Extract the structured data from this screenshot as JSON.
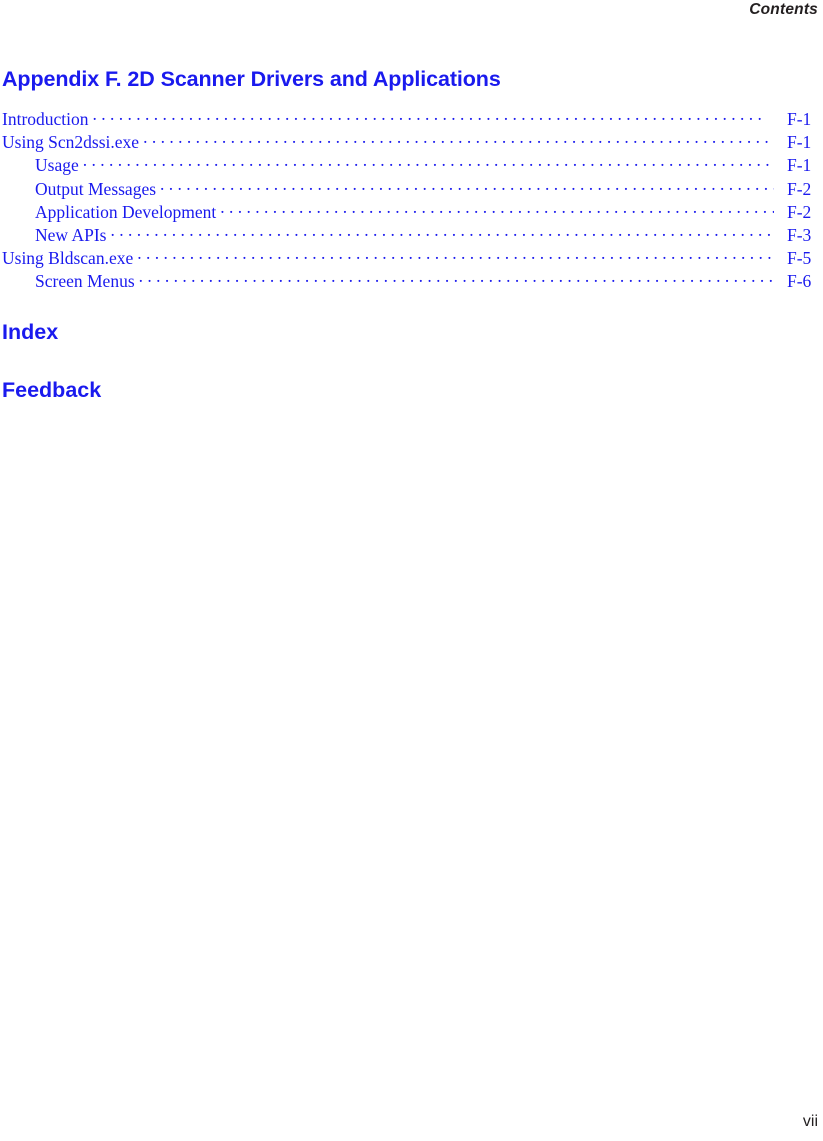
{
  "header": {
    "running_head": "Contents"
  },
  "appendix": {
    "title": "Appendix F. 2D Scanner Drivers and Applications"
  },
  "toc": {
    "entries": [
      {
        "label": "Introduction",
        "page": "F-1",
        "level": 1,
        "gap": "wide"
      },
      {
        "label": "Using Scn2dssi.exe",
        "page": "F-1",
        "level": 1,
        "gap": "small"
      },
      {
        "label": "Usage",
        "page": "F-1",
        "level": 2,
        "gap": "mid"
      },
      {
        "label": "Output Messages",
        "page": "F-2",
        "level": 2,
        "gap": "small"
      },
      {
        "label": "Application Development",
        "page": "F-2",
        "level": 2,
        "gap": "small"
      },
      {
        "label": "New APIs",
        "page": "F-3",
        "level": 2,
        "gap": "small"
      },
      {
        "label": "Using Bldscan.exe",
        "page": "F-5",
        "level": 1,
        "gap": "small"
      },
      {
        "label": "Screen Menus",
        "page": "F-6",
        "level": 2,
        "gap": "small"
      }
    ]
  },
  "sections": {
    "index": "Index",
    "feedback": "Feedback"
  },
  "folio": {
    "page_number": "vii"
  },
  "colors": {
    "link_blue": "#1a1aee",
    "body_black": "#231f20",
    "page_background": "#ffffff"
  }
}
